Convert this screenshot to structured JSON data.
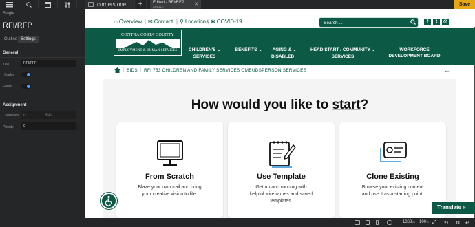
{
  "app": {
    "tab_cornerstone": "cornerstone",
    "tab_edited_title": "Edited - RFI/RFP",
    "tab_edited_sub": "SINGLE",
    "save_label": "Save"
  },
  "left_panel": {
    "subtitle": "Single",
    "title": "RFI/RFP",
    "tabs": [
      "Outline",
      "Settings"
    ],
    "general_heading": "General",
    "title_label": "Title",
    "title_value": "RFI/RFP",
    "header_label": "Header",
    "footer_label": "Footer",
    "assignment_heading": "Assignment",
    "conditions_label": "Conditions",
    "conditions_button": "Edit",
    "priority_label": "Priority",
    "priority_value": "0"
  },
  "site": {
    "util_links": [
      "Overview",
      "Contact",
      "Locations",
      "COVID-19"
    ],
    "search_placeholder": "Search ...",
    "logo_top": "CONTRA COSTA COUNTY",
    "logo_bottom": "EMPLOYMENT & HUMAN SERVICES",
    "nav": [
      {
        "line1": "CHILDREN'S",
        "line2": "SERVICES"
      },
      {
        "line1": "BENEFITS",
        "line2": ""
      },
      {
        "line1": "AGING &",
        "line2": "DISABLED"
      },
      {
        "line1": "HEAD START / COMMUNITY",
        "line2": "SERVICES"
      },
      {
        "line1": "WORKFORCE",
        "line2": "DEVELOPMENT BOARD"
      }
    ],
    "breadcrumb": [
      "BIDS",
      "RFI 753 CHILDREN AND FAMILY SERVICES OMBUDSPERSON SERVICES"
    ],
    "heading_pre": "How would you like to ",
    "heading_u": "start",
    "heading_post": "?",
    "cards": [
      {
        "title": "From Scratch",
        "desc": "Blaze your own trail and bring your creative vision to life."
      },
      {
        "title": "Use Template",
        "desc": "Get up and running with helpful wireframes and saved templates."
      },
      {
        "title": "Clone Existing",
        "desc": "Browse your existing content and use it as a starting point."
      }
    ],
    "translate_label": "Translate »"
  },
  "bottom_bar": {
    "width_value": "1368",
    "width_unit": "px",
    "zoom_value": "100",
    "zoom_unit": "%"
  },
  "colors": {
    "brand_green": "#0c5a45",
    "save_accent": "#e7a613",
    "toggle_on": "#4da3ff"
  }
}
